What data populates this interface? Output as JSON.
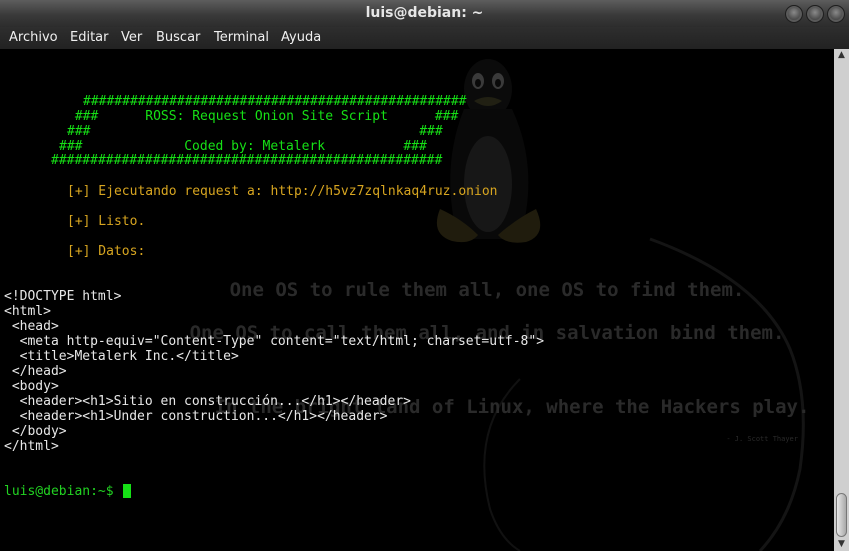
{
  "window": {
    "title": "luis@debian: ~"
  },
  "menu": [
    "Archivo",
    "Editar",
    "Ver",
    "Buscar",
    "Terminal",
    "Ayuda"
  ],
  "wallpaper": {
    "lines": [
      "One OS to rule them all, one OS to find them.",
      "One OS to call them all, and in salvation bind them.",
      "In the bright land of Linux, where the Hackers play."
    ],
    "attribution": "- J. Scott Thayer"
  },
  "terminal": {
    "banner": [
      "#################################################",
      " ###      ROSS: Request Onion Site Script      ###",
      "###                                          ###",
      "###             Coded by: Metalerk          ###",
      "##################################################"
    ],
    "status": [
      "[+] Ejecutando request a: http://h5vz7zqlnkaq4ruz.onion",
      "[+] Listo.",
      "[+] Datos:"
    ],
    "html_output": [
      "<!DOCTYPE html>",
      "<html>",
      " <head>",
      "  <meta http-equiv=\"Content-Type\" content=\"text/html; charset=utf-8\">",
      "  <title>Metalerk Inc.</title>",
      " </head>",
      " <body>",
      "  <header><h1>Sitio en construcción...</h1></header>",
      "  <header><h1>Under construction...</h1></header>",
      " </body>",
      "</html>"
    ],
    "prompt": "luis@debian:~$ "
  },
  "colors": {
    "prompt": "#16e016",
    "banner": "#16e016",
    "status": "#d7a520",
    "text": "#e8e8e8"
  }
}
